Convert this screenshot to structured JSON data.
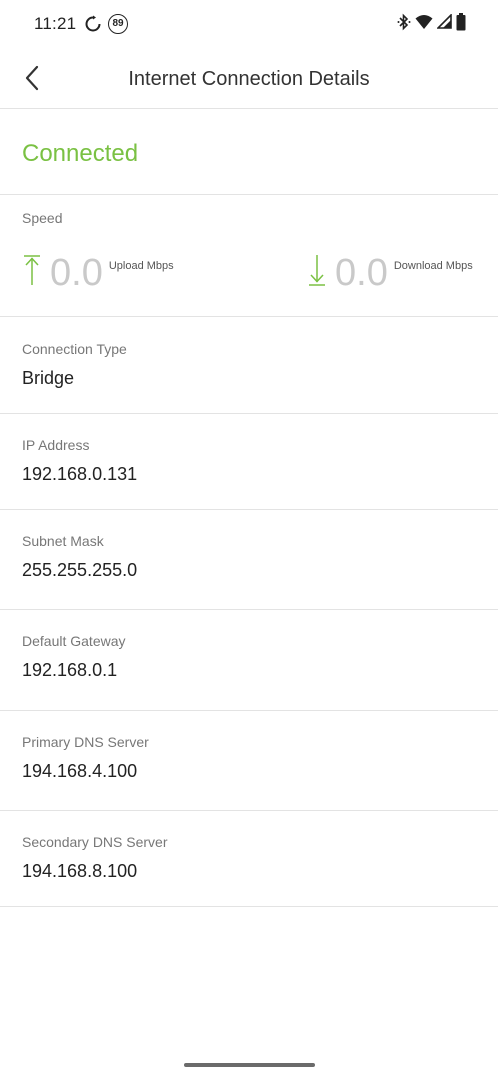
{
  "status_bar": {
    "time": "11:21",
    "badge": "89",
    "icons": [
      "sync-icon",
      "notification-count-badge",
      "bluetooth-icon",
      "wifi-icon",
      "cellular-signal-icon",
      "battery-icon"
    ]
  },
  "header": {
    "title": "Internet Connection Details",
    "back_icon": "chevron-left-icon"
  },
  "connection": {
    "status": "Connected",
    "status_color": "#7ac143"
  },
  "speed": {
    "label": "Speed",
    "upload": {
      "value": "0.0",
      "unit": "Upload Mbps",
      "icon": "upload-arrow-icon"
    },
    "download": {
      "value": "0.0",
      "unit": "Download Mbps",
      "icon": "download-arrow-icon"
    }
  },
  "details": [
    {
      "label": "Connection Type",
      "value": "Bridge"
    },
    {
      "label": "IP Address",
      "value": "192.168.0.131"
    },
    {
      "label": "Subnet Mask",
      "value": "255.255.255.0"
    },
    {
      "label": "Default Gateway",
      "value": "192.168.0.1"
    },
    {
      "label": "Primary DNS Server",
      "value": "194.168.4.100"
    },
    {
      "label": "Secondary DNS Server",
      "value": "194.168.8.100"
    }
  ],
  "colors": {
    "accent_green": "#7ac143",
    "speed_value_gray": "#c9c9c9",
    "divider": "#e3e3e3"
  }
}
